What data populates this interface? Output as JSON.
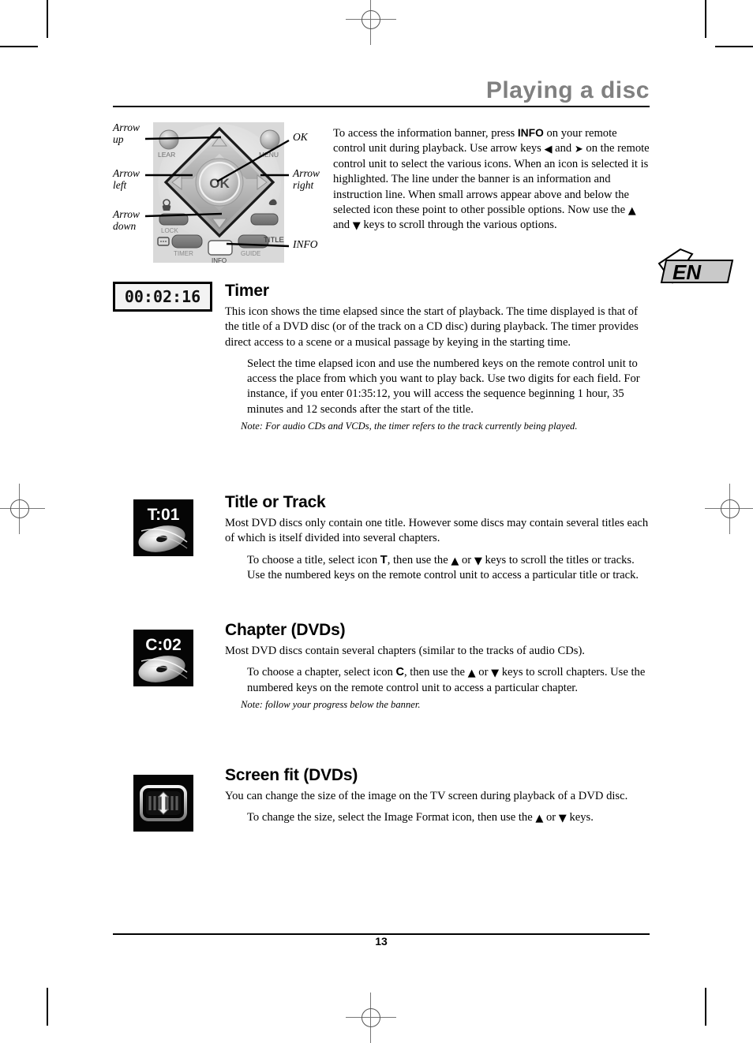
{
  "document": {
    "page_title": "Playing a disc",
    "page_number": "13",
    "language_badge": "EN"
  },
  "figure": {
    "callouts": {
      "arrow_up": "Arrow\nup",
      "arrow_left": "Arrow\nleft",
      "arrow_down": "Arrow\ndown",
      "ok": "OK",
      "arrow_right": "Arrow\nright",
      "info": "INFO"
    },
    "remote_key_labels": {
      "clear": "LEAR",
      "menu": "MENU",
      "lock": "LOCK",
      "timer": "TIMER",
      "info": "INFO",
      "guide": "GUIDE",
      "title": "TITLE",
      "ok": "OK"
    }
  },
  "intro": {
    "part1": "To access the information banner, press ",
    "bold1": "INFO",
    "part2": " on your remote control unit during playback. Use arrow keys ",
    "arrow_left_glyph": "◀",
    "part3": " and ",
    "arrow_right_glyph": "➤",
    "part4": " on the remote control unit to select the various icons. When an icon is selected it is highlighted. The line under the banner is an information and instruction line. When small arrows appear above and below the selected icon these point to other possible options. Now use the ",
    "arrow_up_glyph": "▲",
    "part5": " and ",
    "arrow_down_glyph": "▼",
    "part6": " keys to scroll through the various options."
  },
  "sections": [
    {
      "id": "timer",
      "icon_type": "timer-readout",
      "icon_text": "00:02:16",
      "heading": "Timer",
      "paragraph": "This icon shows the time elapsed since the start of playback. The time displayed is that of the title of a DVD disc (or of the track on a CD disc) during playback. The timer provides direct access to a scene or a musical passage by keying in the starting time.",
      "indent": "Select the time elapsed icon and use the numbered keys on the remote control unit to access the place from which you want to play back. Use two digits for each field. For instance, if you enter 01:35:12, you will access the sequence beginning 1 hour, 35 minutes and 12 seconds after the start of the title.",
      "note": "Note: For audio CDs and VCDs, the timer refers to the track currently being played."
    },
    {
      "id": "title-or-track",
      "icon_type": "disc-badge",
      "icon_text": "T:01",
      "heading": "Title or Track",
      "paragraph": "Most DVD discs only contain one title. However some discs may contain several titles each of which is itself divided into several chapters.",
      "indent_pre": "To choose a title, select icon ",
      "indent_key": "T",
      "indent_mid": ", then use the ",
      "indent_or": " or ",
      "indent_post": " keys to scroll the titles or tracks. Use the numbered keys on the remote control unit to access a particular title or track.",
      "note": ""
    },
    {
      "id": "chapter",
      "icon_type": "disc-badge",
      "icon_text": "C:02",
      "heading": "Chapter (DVDs)",
      "paragraph": "Most DVD discs contain several chapters (similar to the tracks of audio CDs).",
      "indent_pre": "To choose a chapter, select icon ",
      "indent_key": "C",
      "indent_mid": ", then use the ",
      "indent_or": " or ",
      "indent_post": " keys to scroll chapters. Use the numbered keys on the remote control unit to access a particular chapter.",
      "note": "Note: follow your progress below the banner."
    },
    {
      "id": "screen-fit",
      "icon_type": "screen-fit",
      "icon_text": "",
      "heading": "Screen fit (DVDs)",
      "paragraph": "You can change the size of the image on the TV screen during playback of a DVD disc.",
      "indent_pre": "To change the size, select the Image Format icon, then use the ",
      "indent_key": "",
      "indent_mid": "",
      "indent_or": " or ",
      "indent_post": " keys.",
      "note": ""
    }
  ],
  "glyphs": {
    "arrow_up": "▲",
    "arrow_down": "▼",
    "arrow_left": "◀",
    "arrow_right": "➤"
  },
  "colors": {
    "title_gray": "#808080",
    "remote_bg": "#d9d9d9",
    "icon_bg": "#000000",
    "badge_fill": "#c9c9c9"
  }
}
